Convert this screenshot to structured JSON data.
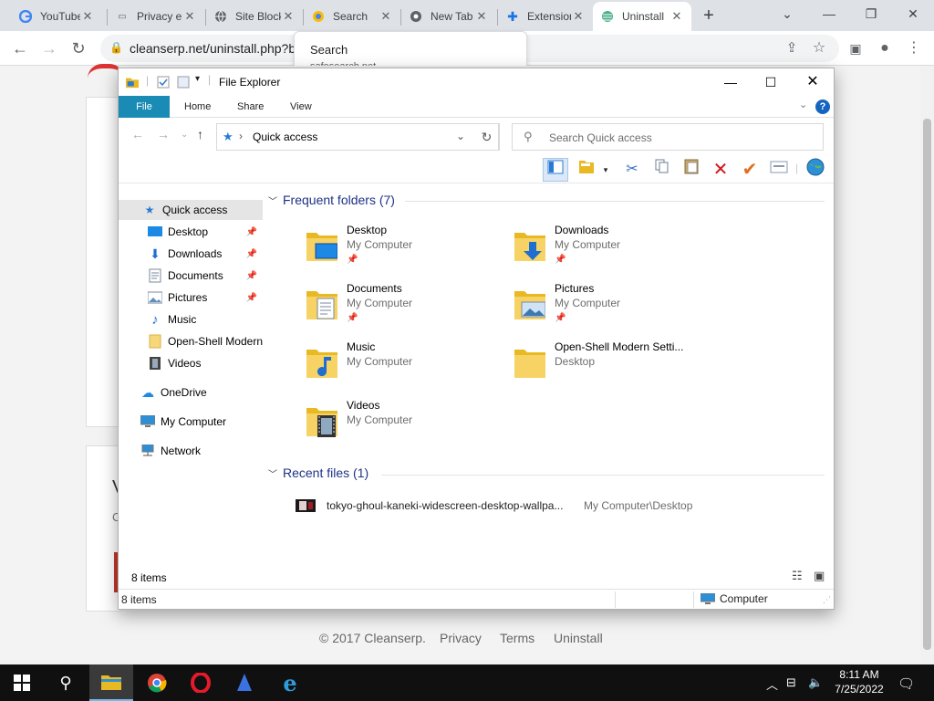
{
  "browser": {
    "tabs": [
      {
        "title": "YouTube",
        "icon": "google-icon"
      },
      {
        "title": "Privacy error",
        "icon": "warning-icon"
      },
      {
        "title": "Site Blocked",
        "icon": "globe-icon"
      },
      {
        "title": "Search",
        "icon": "search-icon"
      },
      {
        "title": "New Tab",
        "icon": "chrome-icon"
      },
      {
        "title": "Extensions",
        "icon": "puzzle-icon"
      },
      {
        "title": "Uninstall",
        "icon": "cleanserp-icon"
      }
    ],
    "url": "cleanserp.net/uninstall.php?b",
    "suggestion_title": "Search",
    "suggestion_sub": "safesearch.net"
  },
  "webpage": {
    "footer_copyright": "© 2017 Cleanserp.",
    "footer_links": [
      "Privacy",
      "Terms",
      "Uninstall"
    ],
    "card2_letter1": "V",
    "card2_letter2": "C"
  },
  "explorer": {
    "title": "File Explorer",
    "ribbon_tabs": [
      "File",
      "Home",
      "Share",
      "View"
    ],
    "address": "Quick access",
    "search_placeholder": "Search Quick access",
    "nav_items": [
      {
        "label": "Quick access",
        "icon": "star-icon",
        "pinned": false
      },
      {
        "label": "Desktop",
        "icon": "desktop-icon",
        "pinned": true
      },
      {
        "label": "Downloads",
        "icon": "download-icon",
        "pinned": true
      },
      {
        "label": "Documents",
        "icon": "document-icon",
        "pinned": true
      },
      {
        "label": "Pictures",
        "icon": "picture-icon",
        "pinned": true
      },
      {
        "label": "Music",
        "icon": "music-icon",
        "pinned": false
      },
      {
        "label": "Open-Shell Modern",
        "icon": "folder-icon",
        "pinned": false
      },
      {
        "label": "Videos",
        "icon": "video-icon",
        "pinned": false
      },
      {
        "label": "OneDrive",
        "icon": "cloud-icon",
        "pinned": false
      },
      {
        "label": "My Computer",
        "icon": "computer-icon",
        "pinned": false
      },
      {
        "label": "Network",
        "icon": "network-icon",
        "pinned": false
      }
    ],
    "frequent_header": "Frequent folders (7)",
    "folders": [
      {
        "name": "Desktop",
        "location": "My Computer",
        "pinned": true
      },
      {
        "name": "Downloads",
        "location": "My Computer",
        "pinned": true
      },
      {
        "name": "Documents",
        "location": "My Computer",
        "pinned": true
      },
      {
        "name": "Pictures",
        "location": "My Computer",
        "pinned": true
      },
      {
        "name": "Music",
        "location": "My Computer",
        "pinned": false
      },
      {
        "name": "Open-Shell Modern Setti...",
        "location": "Desktop",
        "pinned": false
      },
      {
        "name": "Videos",
        "location": "My Computer",
        "pinned": false
      }
    ],
    "recent_header": "Recent files (1)",
    "recent_files": [
      {
        "name": "tokyo-ghoul-kaneki-widescreen-desktop-wallpa...",
        "path": "My Computer\\Desktop"
      }
    ],
    "item_count": "8 items",
    "status_count": "8 items",
    "status_location": "Computer"
  },
  "taskbar": {
    "time": "8:11 AM",
    "date": "7/25/2022"
  },
  "colors": {
    "file_tab": "#1a8bb5",
    "group_header": "#1e3287",
    "taskbar": "#101010"
  }
}
